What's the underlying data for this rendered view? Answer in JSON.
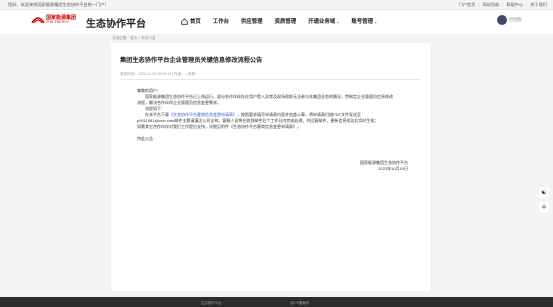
{
  "topbar": {
    "greeting": "您好，欢迎来到国家能源集团生态协作平台统一门户！",
    "links": [
      "门户首页",
      "网站导航",
      "帮助中心",
      "关于我们"
    ]
  },
  "brand": {
    "cn": "国家能源集团",
    "en": "CHN ENERGY",
    "platform": "生态协作平台"
  },
  "nav": {
    "items": [
      {
        "label": "首页"
      },
      {
        "label": "工作台"
      },
      {
        "label": "供应管理"
      },
      {
        "label": "资质管理"
      },
      {
        "label": "开通业务域"
      },
      {
        "label": "账号管理"
      }
    ]
  },
  "user": {
    "name": "*****公司"
  },
  "breadcrumb": "当前位置：首页 > 系统公告",
  "notice": {
    "title": "集团生态协作平台企业管理员关键信息修改流程公告",
    "meta": "发布时间：2023-11-20 08:59:12  |  作者：  |  来源：",
    "salutation": "尊敬的用户：",
    "para1": "国家能源集团生态协作平台已上线运行，部分合作伙伴存在用户登入异常及现场帮助无法参与本集团业务的情况，特制定企业管理员信息修改",
    "para2": "流程，解决合作伙伴企业管理员信息变更需求。",
    "para3": "流程如下：",
    "para4_prefix": "在本平台下载",
    "para4_link": "《生态协作平台客商信息变更申请表》",
    "para4_suffix": "，按照要求填写申请表内容并加盖公章，将申请表扫描PDF文件发送至",
    "para5": "p0011981@ceic.com邮件主题请填注公司全称。客服人员将在收到邮件后个工作日内完成处理，并回复邮件，更新信息成功后实时生效；",
    "para6": "如需其它合作伙伴对我们工作提出支持，详细见附件《生态协作平台客商信息变更申请表》。",
    "closing": "特此公告",
    "sign_org": "国家能源集团生态协作平台",
    "sign_date": "2023年10月19日"
  },
  "footer": {
    "left": "生态协作平台",
    "right": "京ICP备案号"
  },
  "float_buttons": {
    "top": "☯",
    "bottom": "✲"
  }
}
